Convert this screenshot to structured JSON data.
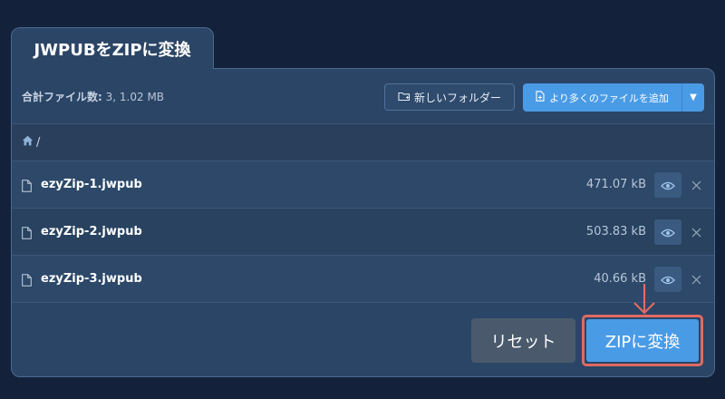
{
  "tab": {
    "title": "JWPUBをZIPに変換"
  },
  "toolbar": {
    "summary_label": "合計ファイル数:",
    "summary_value": "3, 1.02 MB",
    "new_folder_label": "新しいフォルダー",
    "add_files_label": "より多くのファイルを追加",
    "dropdown_icon": "caret-down-icon"
  },
  "path": {
    "separator": "/",
    "home_icon": "home-icon"
  },
  "files": [
    {
      "name": "ezyZip-1.jwpub",
      "size": "471.07 kB"
    },
    {
      "name": "ezyZip-2.jwpub",
      "size": "503.83 kB"
    },
    {
      "name": "ezyZip-3.jwpub",
      "size": "40.66 kB"
    }
  ],
  "actions": {
    "reset_label": "リセット",
    "convert_label": "ZIPに変換"
  },
  "colors": {
    "page_bg": "#13223a",
    "panel_bg": "#2b4566",
    "accent": "#4a9be6",
    "highlight": "#e06a62",
    "reset_bg": "#4a5a6c"
  }
}
